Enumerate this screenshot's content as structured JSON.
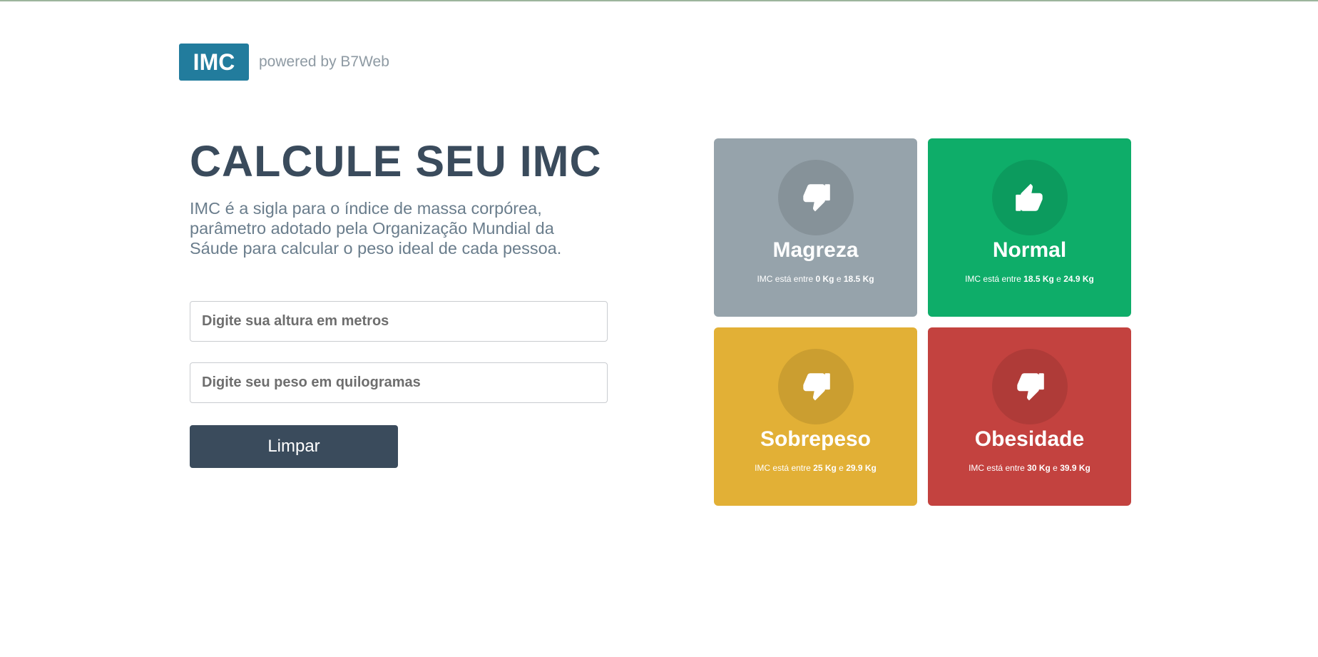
{
  "header": {
    "logo_text": "IMC",
    "powered_by": "powered by B7Web"
  },
  "main": {
    "title": "CALCULE SEU IMC",
    "description": "IMC é a sigla para o índice de massa corpórea, parâmetro adotado pela Organização Mundial da Sáude para calcular o peso ideal de cada pessoa.",
    "height_placeholder": "Digite sua altura em metros",
    "weight_placeholder": "Digite seu peso em quilogramas",
    "button_label": "Limpar"
  },
  "levels": [
    {
      "title": "Magreza",
      "prefix": "IMC está entre",
      "min": "0 Kg",
      "conj": "e",
      "max": "18.5 Kg",
      "icon": "thumbs-down-icon",
      "color": "#96a3ab"
    },
    {
      "title": "Normal",
      "prefix": "IMC está entre",
      "min": "18.5 Kg",
      "conj": "e",
      "max": "24.9 Kg",
      "icon": "thumbs-up-icon",
      "color": "#0ead69"
    },
    {
      "title": "Sobrepeso",
      "prefix": "IMC está entre",
      "min": "25 Kg",
      "conj": "e",
      "max": "29.9 Kg",
      "icon": "thumbs-down-icon",
      "color": "#e2b036"
    },
    {
      "title": "Obesidade",
      "prefix": "IMC está entre",
      "min": "30 Kg",
      "conj": "e",
      "max": "39.9 Kg",
      "icon": "thumbs-down-icon",
      "color": "#c3423f"
    }
  ],
  "colors": {
    "brand": "#227c9d",
    "title": "#3a4b5c",
    "button": "#3a4b5c"
  }
}
